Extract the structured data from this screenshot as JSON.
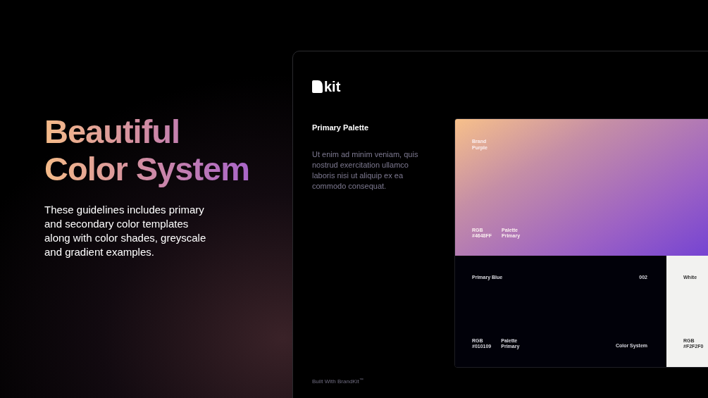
{
  "hero": {
    "title_lines": [
      "Beautiful",
      "Color System"
    ],
    "description": "These guidelines includes primary and secondary color templates along with color shades, greyscale and gradient examples."
  },
  "mockup": {
    "logo": "kit",
    "section_title": "Primary Palette",
    "body": "Ut enim ad minim veniam, quis nostrud exercitation ullamco laboris nisi ut aliquip ex ea commodo consequat.",
    "footer": "Built With BrandKit$^{™}$",
    "swatches": [
      {
        "kind": "gradient",
        "name": "Brand Purple",
        "rgb_label": "RGB",
        "hex": "#4648FF",
        "palette_label": "Palette",
        "palette_value": "Primary"
      },
      {
        "kind": "solid",
        "color": "#010109",
        "name": "Primary Blue",
        "number": "002",
        "rgb_label": "RGB",
        "hex": "#010109",
        "palette_label": "Palette",
        "palette_value": "Primary",
        "caption": "Color System"
      },
      {
        "kind": "solid",
        "color": "#f2f2f0",
        "name": "White",
        "rgb_label": "RGB",
        "hex": "#F2F2F0"
      }
    ]
  }
}
